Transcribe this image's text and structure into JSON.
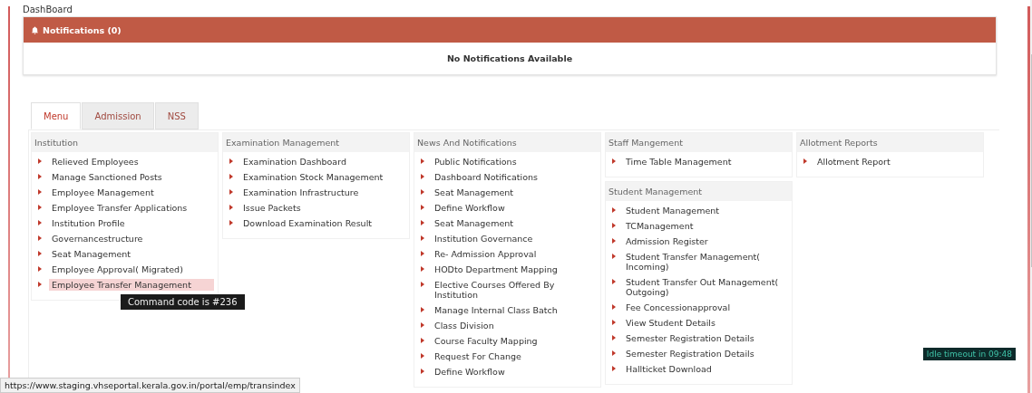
{
  "breadcrumb": "DashBoard",
  "notifications": {
    "title": "Notifications (0)",
    "empty_text": "No Notifications Available"
  },
  "tabs": [
    {
      "label": "Menu",
      "selected": true
    },
    {
      "label": "Admission",
      "selected": false
    },
    {
      "label": "NSS",
      "selected": false
    }
  ],
  "columns": [
    {
      "sections": [
        {
          "title": "Institution",
          "items": [
            {
              "label": "Relieved Employees",
              "highlighted": false
            },
            {
              "label": "Manage Sanctioned Posts",
              "highlighted": false
            },
            {
              "label": "Employee Management",
              "highlighted": false
            },
            {
              "label": "Employee Transfer Applications",
              "highlighted": false
            },
            {
              "label": "Institution Profile",
              "highlighted": false
            },
            {
              "label": "Governancestructure",
              "highlighted": false
            },
            {
              "label": "Seat Management",
              "highlighted": false
            },
            {
              "label": "Employee Approval( Migrated)",
              "highlighted": false
            },
            {
              "label": "Employee Transfer Management",
              "highlighted": true
            }
          ]
        }
      ]
    },
    {
      "sections": [
        {
          "title": "Examination Management",
          "items": [
            {
              "label": "Examination Dashboard",
              "highlighted": false
            },
            {
              "label": "Examination Stock Management",
              "highlighted": false
            },
            {
              "label": "Examination Infrastructure",
              "highlighted": false
            },
            {
              "label": "Issue Packets",
              "highlighted": false
            },
            {
              "label": "Download Examination Result",
              "highlighted": false
            }
          ]
        }
      ]
    },
    {
      "sections": [
        {
          "title": "News And Notifications",
          "items": [
            {
              "label": "Public Notifications",
              "highlighted": false
            },
            {
              "label": "Dashboard Notifications",
              "highlighted": false
            },
            {
              "label": "Seat Management",
              "highlighted": false
            },
            {
              "label": "Define Workflow",
              "highlighted": false
            },
            {
              "label": "Seat Management",
              "highlighted": false
            },
            {
              "label": "Institution Governance",
              "highlighted": false
            },
            {
              "label": "Re- Admission Approval",
              "highlighted": false
            },
            {
              "label": "HODto Department Mapping",
              "highlighted": false
            },
            {
              "label": "Elective Courses Offered By Institution",
              "highlighted": false
            },
            {
              "label": "Manage Internal Class Batch",
              "highlighted": false
            },
            {
              "label": "Class Division",
              "highlighted": false
            },
            {
              "label": "Course Faculty Mapping",
              "highlighted": false
            },
            {
              "label": "Request For Change",
              "highlighted": false
            },
            {
              "label": "Define Workflow",
              "highlighted": false
            }
          ]
        }
      ]
    },
    {
      "sections": [
        {
          "title": "Staff Mangement",
          "items": [
            {
              "label": "Time Table Management",
              "highlighted": false
            }
          ]
        },
        {
          "title": "Student Management",
          "items": [
            {
              "label": "Student Management",
              "highlighted": false
            },
            {
              "label": "TCManagement",
              "highlighted": false
            },
            {
              "label": "Admission Register",
              "highlighted": false
            },
            {
              "label": "Student Transfer Management( Incoming)",
              "highlighted": false
            },
            {
              "label": "Student Transfer Out Management( Outgoing)",
              "highlighted": false
            },
            {
              "label": "Fee Concessionapproval",
              "highlighted": false
            },
            {
              "label": "View Student Details",
              "highlighted": false
            },
            {
              "label": "Semester Registration Details",
              "highlighted": false
            },
            {
              "label": "Semester Registration Details",
              "highlighted": false
            },
            {
              "label": "Hallticket Download",
              "highlighted": false
            }
          ]
        }
      ]
    },
    {
      "sections": [
        {
          "title": "Allotment Reports",
          "items": [
            {
              "label": "Allotment Report",
              "highlighted": false
            }
          ]
        }
      ]
    }
  ],
  "tooltip": "Command code is #236",
  "status_url": "https://www.staging.vhseportal.kerala.gov.in/portal/emp/transindex",
  "idle_timeout": "Idle timeout in 09:48"
}
